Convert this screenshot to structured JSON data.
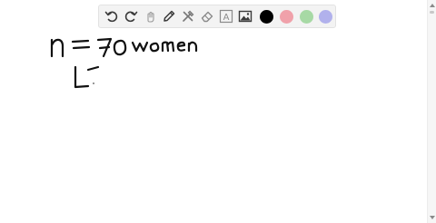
{
  "colors": {
    "toolbar_bg": "#f3f3f3",
    "icon": "#3a3a3a",
    "ink": "#111111",
    "swatches": [
      "#000000",
      "#f0a1aa",
      "#a7d9a5",
      "#b1b1ec"
    ]
  },
  "toolbar": {
    "tools": [
      {
        "name": "undo-icon"
      },
      {
        "name": "redo-icon"
      },
      {
        "name": "select-pointer-icon"
      },
      {
        "name": "pen-icon"
      },
      {
        "name": "tools-icon"
      },
      {
        "name": "eraser-icon"
      },
      {
        "name": "text-icon",
        "label": "A"
      },
      {
        "name": "image-icon"
      }
    ]
  },
  "handwriting": {
    "line1": "n = 70 women",
    "line2": "L-"
  }
}
